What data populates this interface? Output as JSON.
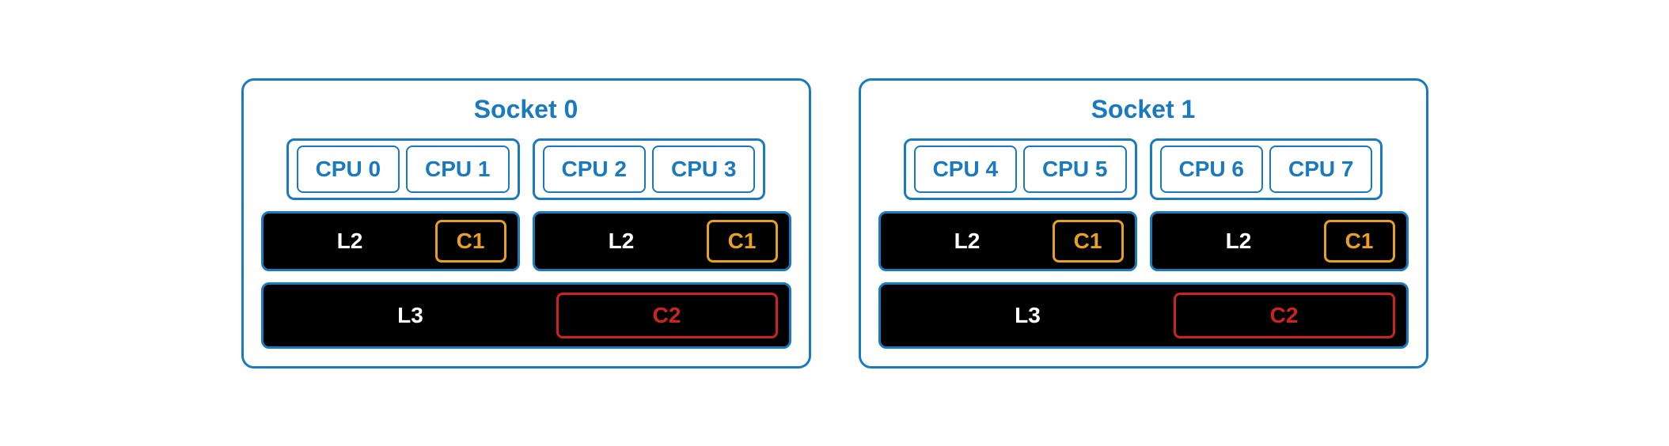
{
  "sockets": [
    {
      "id": "socket-0",
      "title": "Socket 0",
      "cpu_groups": [
        {
          "id": "cpu-group-0",
          "cpus": [
            {
              "id": "cpu-0",
              "label": "CPU 0"
            },
            {
              "id": "cpu-1",
              "label": "CPU 1"
            }
          ]
        },
        {
          "id": "cpu-group-1",
          "cpus": [
            {
              "id": "cpu-2",
              "label": "CPU 2"
            },
            {
              "id": "cpu-3",
              "label": "CPU 3"
            }
          ]
        }
      ],
      "l2_groups": [
        {
          "id": "l2-0",
          "l2_label": "L2",
          "c1_label": "C1"
        },
        {
          "id": "l2-1",
          "l2_label": "L2",
          "c1_label": "C1"
        }
      ],
      "l3": {
        "l3_label": "L3",
        "c2_label": "C2"
      }
    },
    {
      "id": "socket-1",
      "title": "Socket 1",
      "cpu_groups": [
        {
          "id": "cpu-group-2",
          "cpus": [
            {
              "id": "cpu-4",
              "label": "CPU 4"
            },
            {
              "id": "cpu-5",
              "label": "CPU 5"
            }
          ]
        },
        {
          "id": "cpu-group-3",
          "cpus": [
            {
              "id": "cpu-6",
              "label": "CPU 6"
            },
            {
              "id": "cpu-7",
              "label": "CPU 7"
            }
          ]
        }
      ],
      "l2_groups": [
        {
          "id": "l2-2",
          "l2_label": "L2",
          "c1_label": "C1"
        },
        {
          "id": "l2-3",
          "l2_label": "L2",
          "c1_label": "C1"
        }
      ],
      "l3": {
        "l3_label": "L3",
        "c2_label": "C2"
      }
    }
  ]
}
